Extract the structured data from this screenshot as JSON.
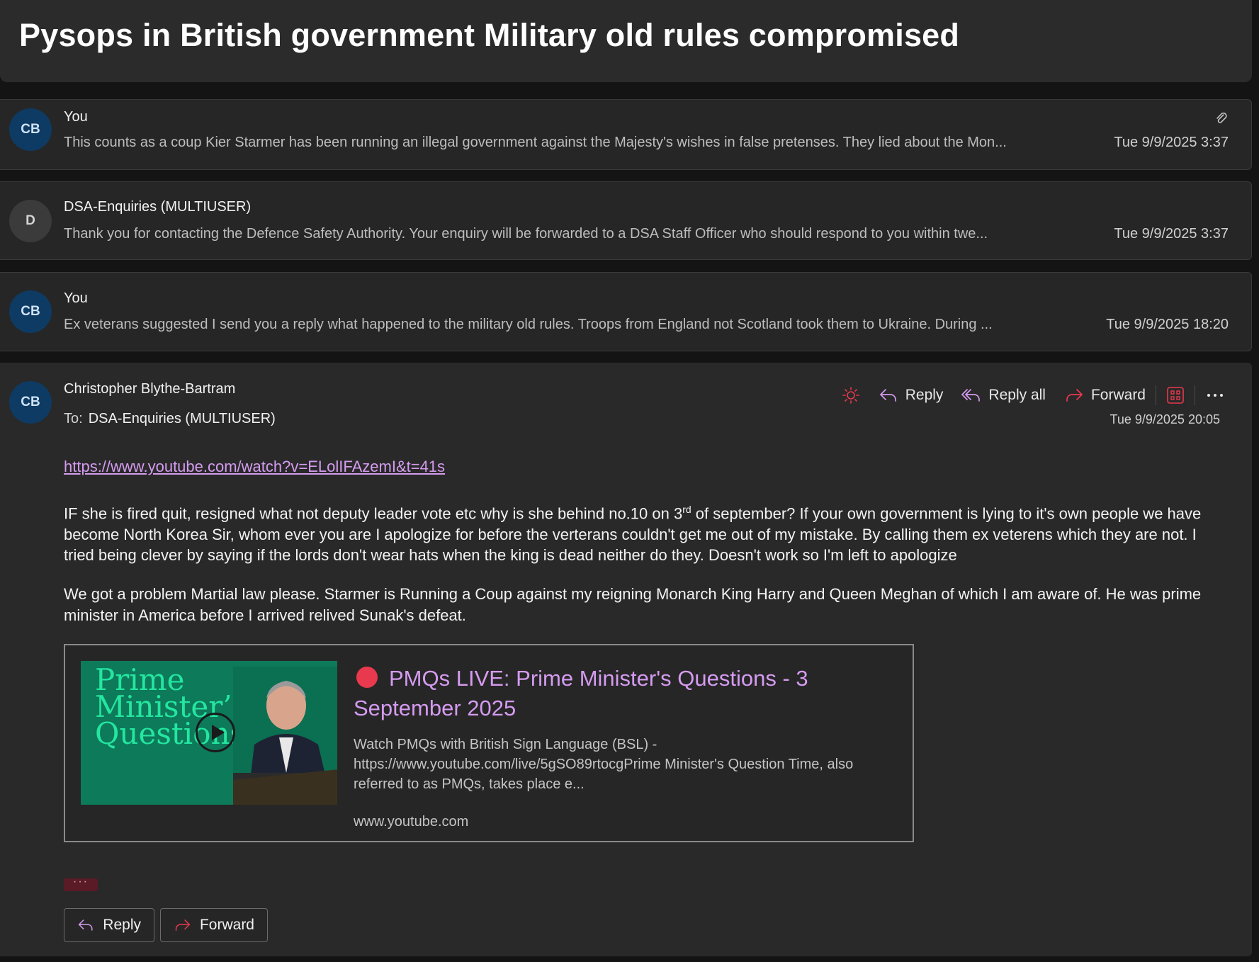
{
  "subject": "Pysops in British government Military old rules compromised",
  "messages": [
    {
      "avatar": "CB",
      "sender": "You",
      "preview": "This counts as a coup Kier Starmer has been running an illegal government against the Majesty's wishes in false pretenses. They lied about the Mon...",
      "date": "Tue 9/9/2025 3:37",
      "has_attachment_icon": "paperclip-icon"
    },
    {
      "avatar": "D",
      "sender": "DSA-Enquiries (MULTIUSER)",
      "preview": "Thank you for contacting the Defence Safety Authority. Your enquiry will be forwarded to a DSA Staff Officer who should respond to you within twe...",
      "date": "Tue 9/9/2025 3:37"
    },
    {
      "avatar": "CB",
      "sender": "You",
      "preview": "Ex veterans suggested I send you a reply what happened to the military old rules. Troops from England not Scotland took them to Ukraine. During ...",
      "date": "Tue 9/9/2025 18:20"
    }
  ],
  "expanded": {
    "avatar": "CB",
    "sender": "Christopher Blythe-Bartram",
    "to_label": "To:",
    "to": "DSA-Enquiries (MULTIUSER)",
    "date": "Tue 9/9/2025 20:05",
    "toolbar": {
      "reply": "Reply",
      "reply_all": "Reply all",
      "forward": "Forward"
    },
    "link": "https://www.youtube.com/watch?v=ELolIFAzemI&t=41s",
    "para1_a": "IF she is fired quit, resigned what not deputy leader vote etc why is she behind no.10 on 3",
    "para1_sup": "rd",
    "para1_b": " of september?   If your own government is lying to it's own people we have become North Korea Sir, whom ever you are I apologize for before the verterans couldn't get me out of my mistake. By calling them ex veterens which they are not. I tried being clever by saying if the lords don't wear hats when the king is dead neither do they. Doesn't work so I'm left to apologize",
    "para2": "We got a problem Martial law please.  Starmer is Running a Coup against my reigning Monarch King Harry and Queen Meghan of which I am aware of. He was prime minister in America before I arrived relived Sunak's defeat.",
    "preview_card": {
      "thumb_lines": [
        "Prime",
        "Minister’s",
        "Questions"
      ],
      "title": "PMQs LIVE: Prime Minister's Questions - 3 September 2025",
      "description": "Watch PMQs with British Sign Language (BSL) - https://www.youtube.com/live/5gSO89rtocgPrime Minister's Question Time, also referred to as PMQs, takes place e...",
      "domain": "www.youtube.com"
    },
    "ellipsis": "···",
    "bottom": {
      "reply": "Reply",
      "forward": "Forward"
    }
  },
  "colors": {
    "accent_link": "#d59bf0",
    "avatar_cb": "#0e3b64",
    "icon_pink": "#e8394f"
  }
}
